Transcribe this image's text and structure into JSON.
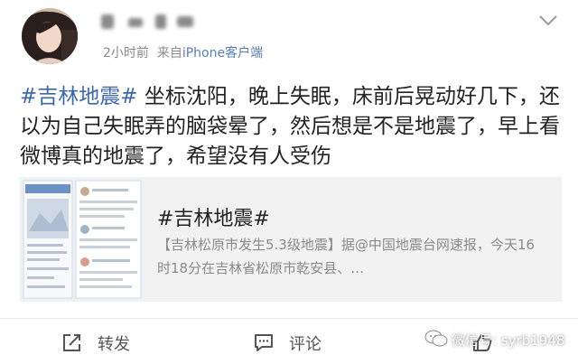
{
  "post": {
    "meta": {
      "time": "2小时前",
      "source_prefix": "来自",
      "source": "iPhone客户端"
    },
    "hashtag": "#吉林地震#",
    "body": " 坐标沈阳，晚上失眠，床前后晃动好几下，还以为自己失眠弄的脑袋晕了，然后想是不是地震了，早上看微博真的地震了，希望没有人受伤"
  },
  "card": {
    "title": "#吉林地震#",
    "description": "【吉林松原市发生5.3级地震】据@中国地震台网速报，今天16时18分在吉林省松原市乾安县、…"
  },
  "actions": {
    "repost_label": "转发",
    "comment_label": "评论"
  },
  "watermark": {
    "text": "微信号: syrb1948"
  },
  "icons": {
    "avatar": "avatar-photo",
    "chevron": "chevron-down-icon",
    "repost": "repost-icon",
    "comment": "comment-icon",
    "like": "like-icon",
    "wechat": "wechat-bubble-icon"
  },
  "colors": {
    "link": "#3f67a6",
    "meta": "#8a8a8a",
    "card_bg": "#f2f2f2"
  }
}
